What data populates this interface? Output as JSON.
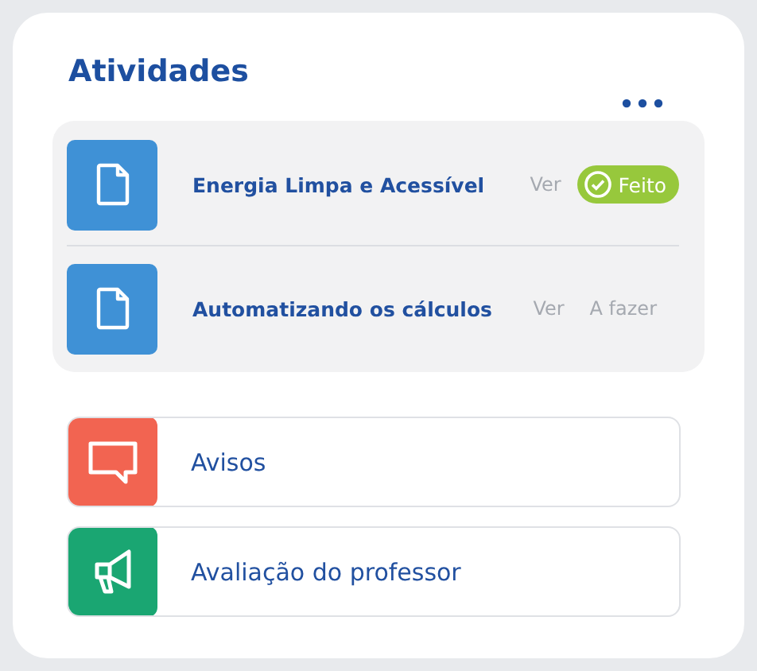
{
  "title": "Atividades",
  "activities": [
    {
      "name": "Energia Limpa e Acessível",
      "action": "Ver",
      "status": "Feito",
      "done": true
    },
    {
      "name": "Automatizando os cálculos",
      "action": "Ver",
      "status": "A fazer",
      "done": false
    }
  ],
  "links": [
    {
      "label": "Avisos",
      "kind": "chat",
      "color": "#f26451"
    },
    {
      "label": "Avaliação do professor",
      "kind": "megaphone",
      "color": "#1aa672"
    }
  ]
}
